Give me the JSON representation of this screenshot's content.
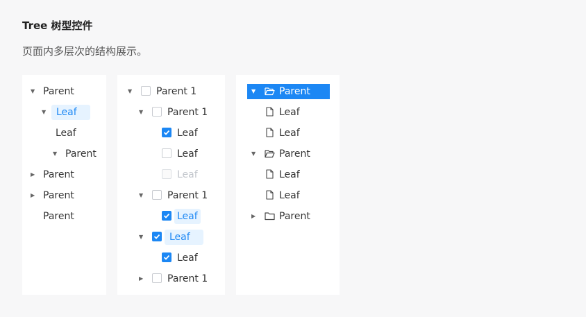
{
  "header": {
    "title": "Tree 树型控件",
    "description": "页面内多层次的结构展示。"
  },
  "tree1": {
    "n1": "Parent",
    "n2": "Leaf",
    "n3": "Leaf",
    "n4": "Parent",
    "n5": "Parent",
    "n6": "Parent",
    "n7": "Parent"
  },
  "tree2": {
    "n1": "Parent 1",
    "n2": "Parent 1",
    "n3": "Leaf",
    "n4": "Leaf",
    "n5": "Leaf",
    "n6": "Parent 1",
    "n7": "Leaf",
    "n8": "Leaf",
    "n9": "Leaf",
    "n10": "Parent 1"
  },
  "tree3": {
    "n1": "Parent",
    "n2": "Leaf",
    "n3": "Leaf",
    "n4": "Parent",
    "n5": "Leaf",
    "n6": "Leaf",
    "n7": "Parent"
  },
  "icons": {
    "expanded": "caret-down-icon",
    "collapsed": "caret-right-icon",
    "folder_open": "folder-open-icon",
    "folder": "folder-icon",
    "file": "file-icon",
    "check": "check-icon"
  },
  "colors": {
    "accent": "#1c87f4",
    "selected_bg": "#e6f3ff",
    "disabled": "#c2c6cc"
  }
}
